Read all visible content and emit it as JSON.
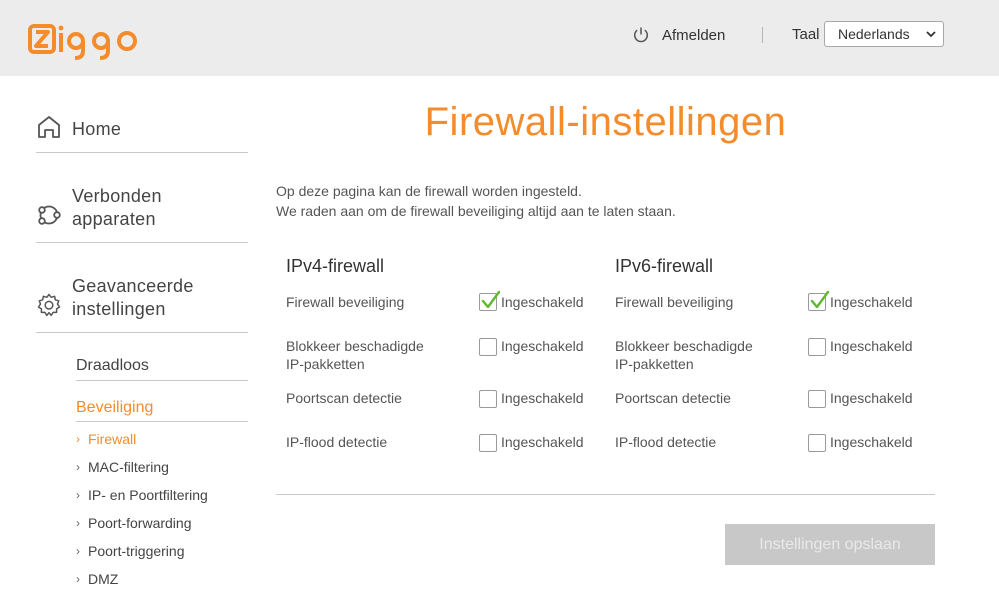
{
  "header": {
    "logo_text": "ziggo",
    "logout_label": "Afmelden",
    "language_label": "Taal",
    "language_selected": "Nederlands"
  },
  "sidebar": {
    "home": "Home",
    "devices": "Verbonden apparaten",
    "devices_line1": "Verbonden",
    "devices_line2": "apparaten",
    "advanced_line1": "Geavanceerde",
    "advanced_line2": "instellingen",
    "wireless": "Draadloos",
    "security": "Beveiliging",
    "security_items": [
      "Firewall",
      "MAC-filtering",
      "IP- en Poortfiltering",
      "Poort-forwarding",
      "Poort-triggering",
      "DMZ"
    ]
  },
  "main": {
    "title": "Firewall-instellingen",
    "intro_line1": "Op deze pagina kan de firewall worden ingesteld.",
    "intro_line2": "We raden aan om de firewall beveiliging altijd aan te laten staan.",
    "ipv4": {
      "title": "IPv4-firewall",
      "rows": [
        {
          "label": "Firewall beveiliging",
          "option": "Ingeschakeld",
          "checked": true
        },
        {
          "label_line1": "Blokkeer beschadigde",
          "label_line2": "IP-pakketten",
          "option": "Ingeschakeld",
          "checked": false
        },
        {
          "label": "Poortscan detectie",
          "option": "Ingeschakeld",
          "checked": false
        },
        {
          "label": "IP-flood detectie",
          "option": "Ingeschakeld",
          "checked": false
        }
      ]
    },
    "ipv6": {
      "title": "IPv6-firewall",
      "rows": [
        {
          "label": "Firewall beveiliging",
          "option": "Ingeschakeld",
          "checked": true
        },
        {
          "label_line1": "Blokkeer beschadigde",
          "label_line2": "IP-pakketten",
          "option": "Ingeschakeld",
          "checked": false
        },
        {
          "label": "Poortscan detectie",
          "option": "Ingeschakeld",
          "checked": false
        },
        {
          "label": "IP-flood detectie",
          "option": "Ingeschakeld",
          "checked": false
        }
      ]
    },
    "save_label": "Instellingen opslaan"
  },
  "colors": {
    "accent": "#f48c2c",
    "check": "#5fb832",
    "topbar": "#ececec",
    "button_disabled": "#c8c8c8"
  }
}
